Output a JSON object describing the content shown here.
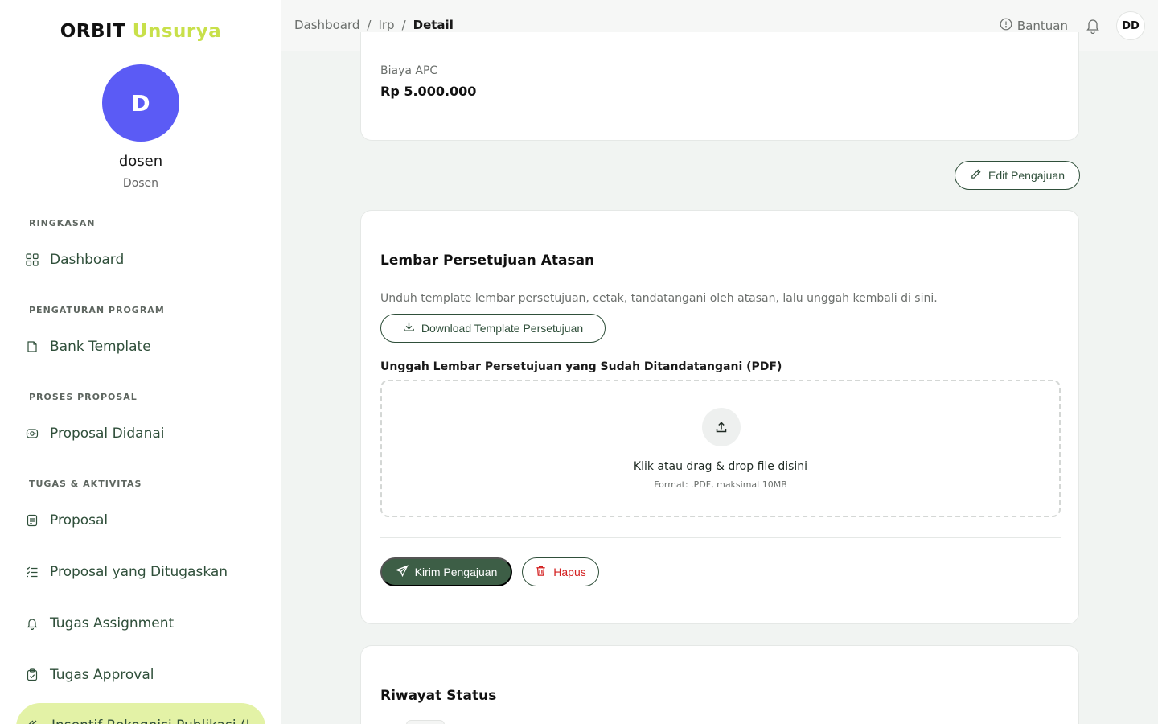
{
  "brand": {
    "part1": "ORBIT",
    "part2": "Unsurya"
  },
  "user": {
    "initial": "D",
    "name": "dosen",
    "role": "Dosen"
  },
  "sidebar": {
    "sections": [
      {
        "label": "RINGKASAN",
        "items": [
          {
            "label": "Dashboard",
            "icon": "grid-icon"
          }
        ]
      },
      {
        "label": "PENGATURAN PROGRAM",
        "items": [
          {
            "label": "Bank Template",
            "icon": "file-icon"
          }
        ]
      },
      {
        "label": "PROSES PROPOSAL",
        "items": [
          {
            "label": "Proposal Didanai",
            "icon": "money-icon"
          }
        ]
      },
      {
        "label": "TUGAS & AKTIVITAS",
        "items": [
          {
            "label": "Proposal",
            "icon": "document-icon"
          },
          {
            "label": "Proposal yang Ditugaskan",
            "icon": "checklist-icon"
          },
          {
            "label": "Tugas Assignment",
            "icon": "bell-icon"
          },
          {
            "label": "Tugas Approval",
            "icon": "clipboard-check-icon"
          }
        ]
      }
    ],
    "active_item": {
      "label": "Insentif Rekognisi Publikasi (I",
      "icon": "reply-icon"
    }
  },
  "topbar": {
    "breadcrumb": [
      "Dashboard",
      "Irp",
      "Detail"
    ],
    "separator": "/",
    "help_label": "Bantuan",
    "user_initials": "DD"
  },
  "apc": {
    "label": "Biaya APC",
    "value": "Rp 5.000.000"
  },
  "edit_button": "Edit Pengajuan",
  "approval": {
    "title": "Lembar Persetujuan Atasan",
    "description": "Unduh template lembar persetujuan, cetak, tandatangani oleh atasan, lalu unggah kembali di sini.",
    "download_label": "Download Template Persetujuan",
    "upload_label": "Unggah Lembar Persetujuan yang Sudah Ditandatangani (PDF)",
    "dropzone_main": "Klik atau drag & drop file disini",
    "dropzone_sub": "Format: .PDF, maksimal 10MB",
    "submit_label": "Kirim Pengajuan",
    "delete_label": "Hapus"
  },
  "history": {
    "title": "Riwayat Status"
  },
  "colors": {
    "accent": "#3d5e46",
    "brand_yellow": "#c8e04a",
    "avatar": "#5b5bf5",
    "danger": "#d32020",
    "active_bg": "#e3f2a6"
  }
}
